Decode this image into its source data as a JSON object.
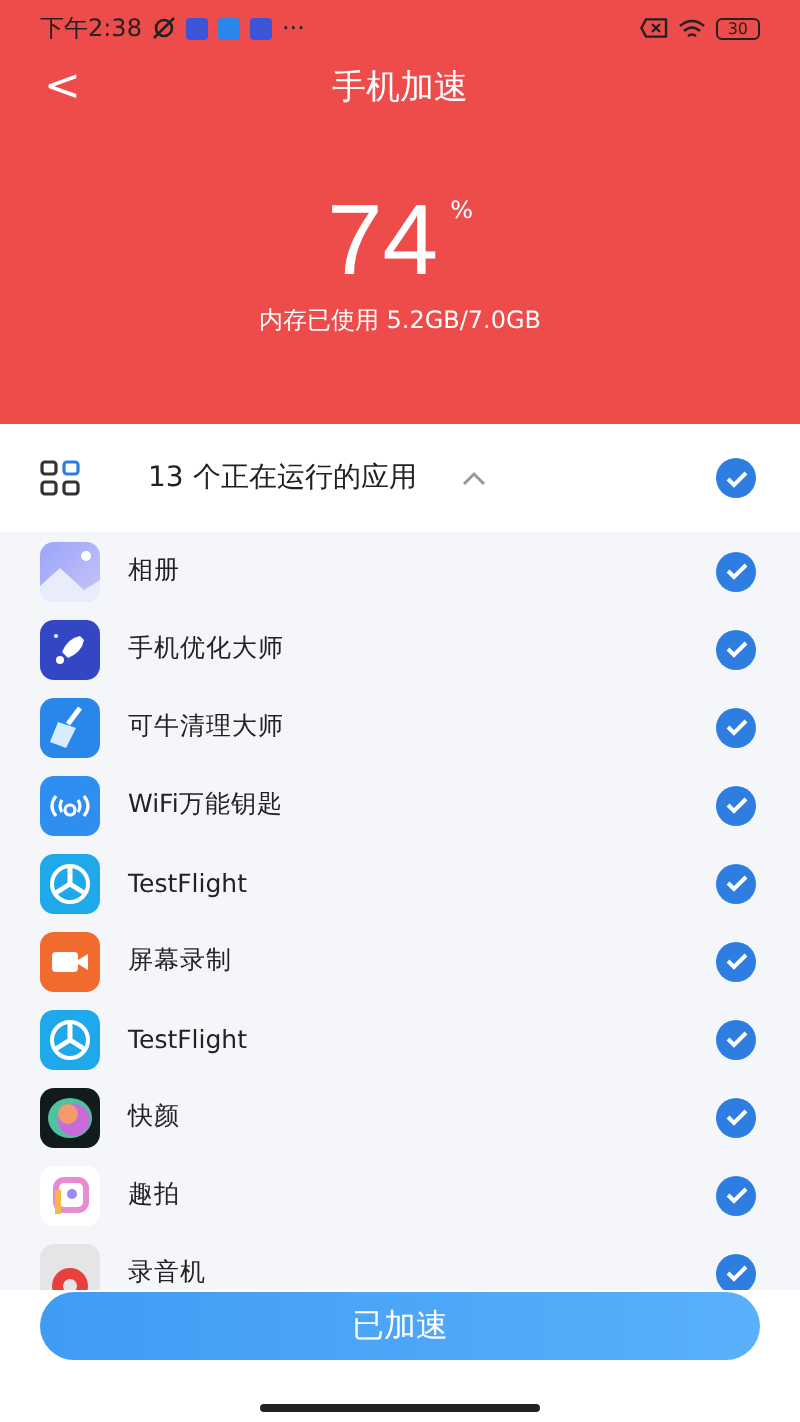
{
  "status_bar": {
    "time": "下午2:38",
    "more": "···",
    "battery": "30"
  },
  "header": {
    "back": "<",
    "title": "手机加速"
  },
  "usage": {
    "percent": "74",
    "unit": "%",
    "caption": "内存已使用 5.2GB/7.0GB"
  },
  "group": {
    "title": "13 个正在运行的应用",
    "expanded": true,
    "checked": true
  },
  "apps": [
    {
      "name": "相册",
      "kind": "gallery",
      "checked": true
    },
    {
      "name": "手机优化大师",
      "kind": "rocket",
      "checked": true
    },
    {
      "name": "可牛清理大师",
      "kind": "broom",
      "checked": true
    },
    {
      "name": "WiFi万能钥匙",
      "kind": "wifi",
      "checked": true
    },
    {
      "name": "TestFlight",
      "kind": "propeller",
      "checked": true
    },
    {
      "name": "屏幕录制",
      "kind": "video",
      "checked": true
    },
    {
      "name": "TestFlight",
      "kind": "propeller",
      "checked": true
    },
    {
      "name": "快颜",
      "kind": "orb",
      "checked": true
    },
    {
      "name": "趣拍",
      "kind": "camera",
      "checked": true
    },
    {
      "name": "录音机",
      "kind": "recorder",
      "checked": true
    }
  ],
  "action": {
    "label": "已加速"
  }
}
